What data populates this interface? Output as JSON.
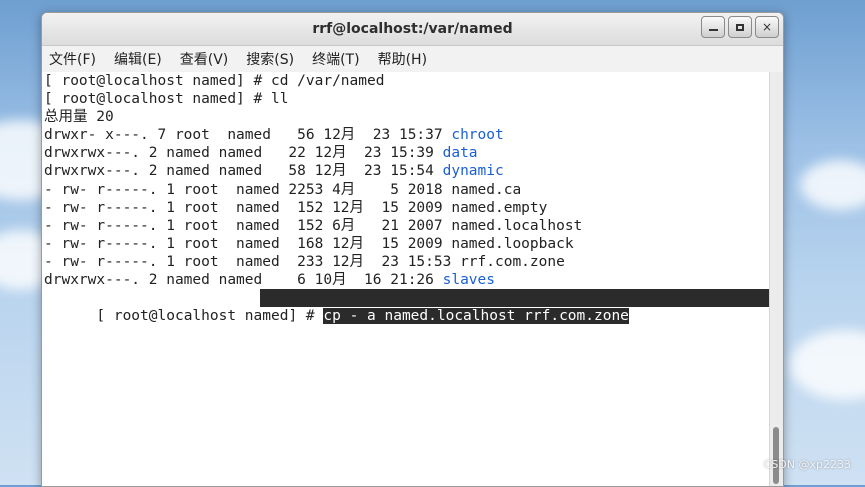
{
  "window": {
    "title": "rrf@localhost:/var/named",
    "buttons": {
      "minimize": "minimize-icon",
      "maximize": "maximize-icon",
      "close": "×"
    }
  },
  "menubar": {
    "items": [
      "文件(F)",
      "编辑(E)",
      "查看(V)",
      "搜索(S)",
      "终端(T)",
      "帮助(H)"
    ]
  },
  "terminal": {
    "lines": [
      "[ root@localhost named] # cd /var/named",
      "[ root@localhost named] # ll",
      "总用量 20"
    ],
    "listing": [
      {
        "text": "drwxr- x---. 7 root  named   56 12月  23 15:37 ",
        "name": "chroot",
        "is_dir": true
      },
      {
        "text": "drwxrwx---. 2 named named   22 12月  23 15:39 ",
        "name": "data",
        "is_dir": true
      },
      {
        "text": "drwxrwx---. 2 named named   58 12月  23 15:54 ",
        "name": "dynamic",
        "is_dir": true
      },
      {
        "text": "- rw- r-----. 1 root  named 2253 4月    5 2018 ",
        "name": "named.ca",
        "is_dir": false
      },
      {
        "text": "- rw- r-----. 1 root  named  152 12月  15 2009 ",
        "name": "named.empty",
        "is_dir": false
      },
      {
        "text": "- rw- r-----. 1 root  named  152 6月   21 2007 ",
        "name": "named.localhost",
        "is_dir": false
      },
      {
        "text": "- rw- r-----. 1 root  named  168 12月  15 2009 ",
        "name": "named.loopback",
        "is_dir": false
      },
      {
        "text": "- rw- r-----. 1 root  named  233 12月  23 15:53 ",
        "name": "rrf.com.zone",
        "is_dir": false
      },
      {
        "text": "drwxrwx---. 2 named named    6 10月  16 21:26 ",
        "name": "slaves",
        "is_dir": true
      }
    ],
    "last_prompt": "[ root@localhost named] # ",
    "last_command": "cp - a named.localhost rrf.com.zone",
    "dir_color": "#1a5fd6"
  },
  "watermark": "CSDN @xp2233"
}
